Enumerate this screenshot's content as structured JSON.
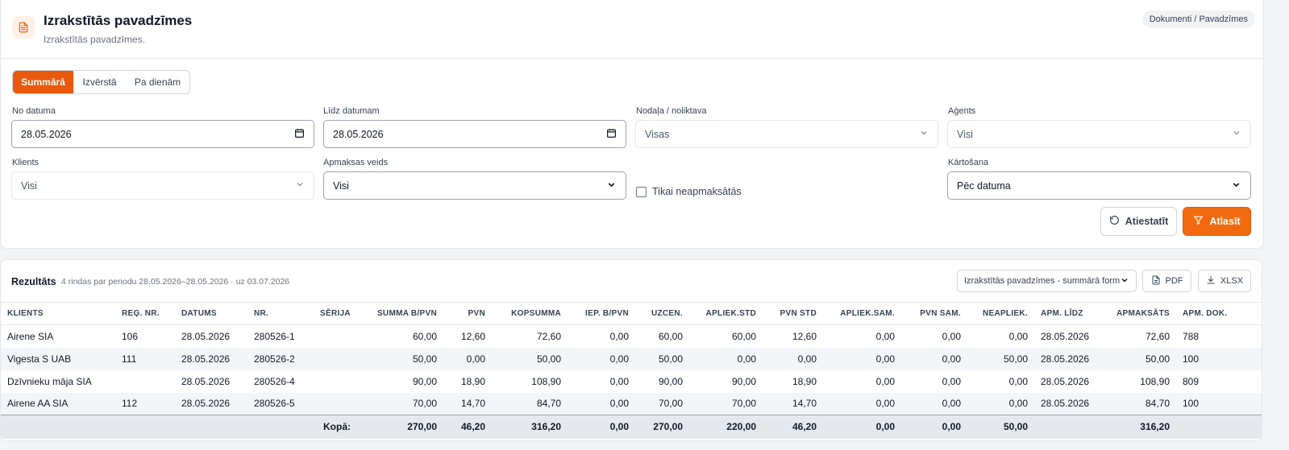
{
  "header": {
    "title": "Izrakstītās pavadzīmes",
    "subtitle": "Izrakstītās pavadzīmes.",
    "breadcrumb": "Dokumenti / Pavadzīmes",
    "icon": "document-icon",
    "accent": "#ea580c"
  },
  "view_tabs": [
    {
      "label": "Summārā",
      "active": true
    },
    {
      "label": "Izvērstā",
      "active": false
    },
    {
      "label": "Pa dienām",
      "active": false
    }
  ],
  "filters": {
    "from_date": {
      "label": "No datuma",
      "value": "28.05.2026"
    },
    "to_date": {
      "label": "Līdz datumam",
      "value": "28.05.2026"
    },
    "department": {
      "label": "Nodaļa / noliktava",
      "value": "Visas"
    },
    "agent": {
      "label": "Aģents",
      "value": "Visi"
    },
    "client": {
      "label": "Klients",
      "value": "Visi"
    },
    "payment_type": {
      "label": "Apmaksas veids",
      "value": "Visi"
    },
    "unpaid_only": {
      "label": "Tikai neapmaksātās",
      "checked": false
    },
    "sorting": {
      "label": "Kārtošana",
      "value": "Pēc datuma"
    }
  },
  "actions": {
    "reset_label": "Atiestatīt",
    "filter_label": "Atlasīt"
  },
  "results": {
    "title": "Rezultāts",
    "meta": "4 rindas par periodu 28.05.2026–28.05.2026 · uz 03.07.2026",
    "report_select": "Izrakstītās pavadzīmes - summārā forma",
    "pdf_label": "PDF",
    "xlsx_label": "XLSX",
    "columns": [
      "KLIENTS",
      "REĢ. NR.",
      "DATUMS",
      "NR.",
      "SĒRIJA",
      "SUMMA B/PVN",
      "PVN",
      "KOPSUMMA",
      "IEP. B/PVN",
      "UZCEN.",
      "APLIEK.STD",
      "PVN STD",
      "APLIEK.SAM.",
      "PVN SAM.",
      "NEAPLIEK.",
      "APM. LĪDZ",
      "APMAKSĀTS",
      "APM. DOK."
    ],
    "rows": [
      [
        "Airene SIA",
        "106",
        "28.05.2026",
        "280526-1",
        "",
        "60,00",
        "12,60",
        "72,60",
        "0,00",
        "60,00",
        "60,00",
        "12,60",
        "0,00",
        "0,00",
        "0,00",
        "28.05.2026",
        "72,60",
        "788"
      ],
      [
        "Vigesta S UAB",
        "111",
        "28.05.2026",
        "280526-2",
        "",
        "50,00",
        "0,00",
        "50,00",
        "0,00",
        "50,00",
        "0,00",
        "0,00",
        "0,00",
        "0,00",
        "50,00",
        "28.05.2026",
        "50,00",
        "100"
      ],
      [
        "Dzīvnieku māja SIA",
        "",
        "28.05.2026",
        "280526-4",
        "",
        "90,00",
        "18,90",
        "108,90",
        "0,00",
        "90,00",
        "90,00",
        "18,90",
        "0,00",
        "0,00",
        "0,00",
        "28.05.2026",
        "108,90",
        "809"
      ],
      [
        "Airene AA SIA",
        "112",
        "28.05.2026",
        "280526-5",
        "",
        "70,00",
        "14,70",
        "84,70",
        "0,00",
        "70,00",
        "70,00",
        "14,70",
        "0,00",
        "0,00",
        "0,00",
        "28.05.2026",
        "84,70",
        "100"
      ]
    ],
    "totals": [
      "",
      "",
      "",
      "",
      "Kopā:",
      "270,00",
      "46,20",
      "316,20",
      "0,00",
      "270,00",
      "220,00",
      "46,20",
      "0,00",
      "0,00",
      "50,00",
      "",
      "316,20",
      ""
    ]
  }
}
